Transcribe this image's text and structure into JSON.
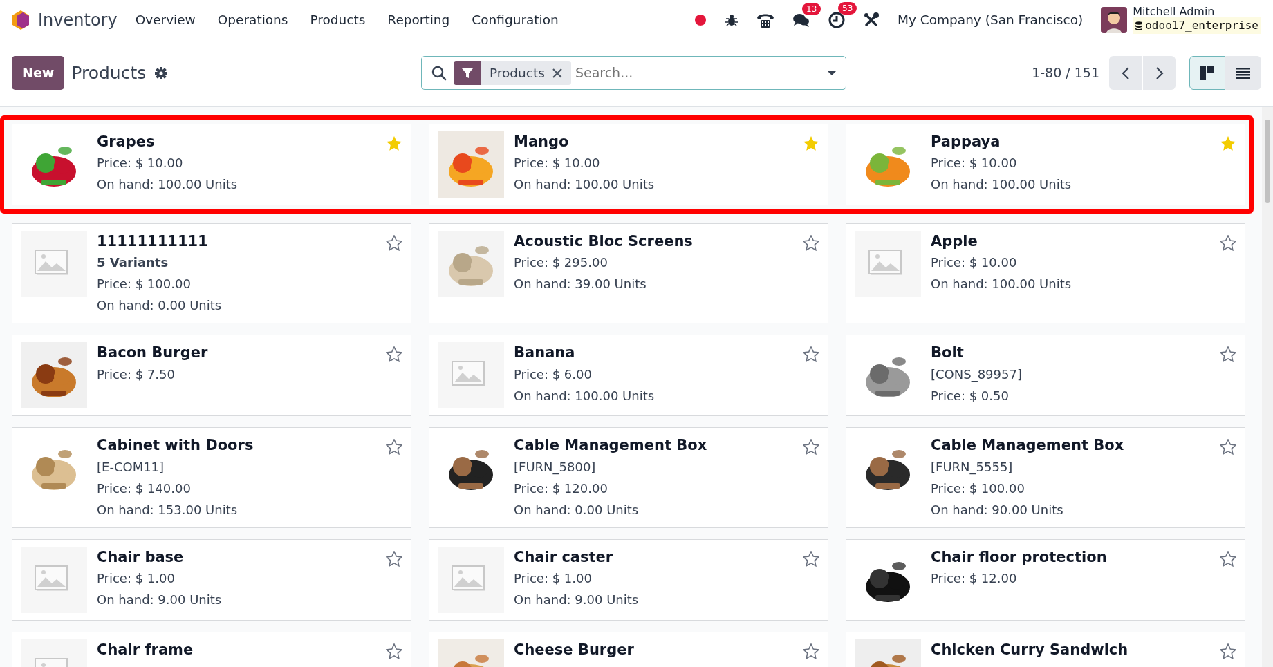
{
  "app": {
    "name": "Inventory"
  },
  "menu": [
    "Overview",
    "Operations",
    "Products",
    "Reporting",
    "Configuration"
  ],
  "systray": {
    "chat_count": "13",
    "activity_count": "53",
    "company": "My Company (San Francisco)",
    "user": "Mitchell Admin",
    "database": "odoo17_enterprise"
  },
  "control_panel": {
    "new_button": "New",
    "title": "Products",
    "facet": "Products",
    "search_placeholder": "Search...",
    "pager": "1-80 / 151",
    "views": [
      {
        "kind": "kanban",
        "selected": true
      },
      {
        "kind": "list",
        "selected": false
      }
    ]
  },
  "rows": [
    {
      "highlighted": true,
      "cards": [
        {
          "name": "Grapes",
          "image": true,
          "favorite": true,
          "lines": [
            {
              "text": "Price: $ 10.00",
              "bold": false
            },
            {
              "text": "On hand: 100.00 Units",
              "bold": false
            }
          ]
        },
        {
          "name": "Mango",
          "image": true,
          "favorite": true,
          "lines": [
            {
              "text": "Price: $ 10.00",
              "bold": false
            },
            {
              "text": "On hand: 100.00 Units",
              "bold": false
            }
          ]
        },
        {
          "name": "Pappaya",
          "image": true,
          "favorite": true,
          "lines": [
            {
              "text": "Price: $ 10.00",
              "bold": false
            },
            {
              "text": "On hand: 100.00 Units",
              "bold": false
            }
          ]
        }
      ]
    },
    {
      "highlighted": false,
      "cards": [
        {
          "name": "11111111111",
          "image": false,
          "favorite": false,
          "lines": [
            {
              "text": "5 Variants",
              "bold": true
            },
            {
              "text": "Price: $ 100.00",
              "bold": false
            },
            {
              "text": "On hand: 0.00 Units",
              "bold": false
            }
          ]
        },
        {
          "name": "Acoustic Bloc Screens",
          "image": true,
          "favorite": false,
          "lines": [
            {
              "text": "Price: $ 295.00",
              "bold": false
            },
            {
              "text": "On hand: 39.00 Units",
              "bold": false
            }
          ]
        },
        {
          "name": "Apple",
          "image": false,
          "favorite": false,
          "lines": [
            {
              "text": "Price: $ 10.00",
              "bold": false
            },
            {
              "text": "On hand: 100.00 Units",
              "bold": false
            }
          ]
        }
      ]
    },
    {
      "highlighted": false,
      "cards": [
        {
          "name": "Bacon Burger",
          "image": true,
          "favorite": false,
          "lines": [
            {
              "text": "Price: $ 7.50",
              "bold": false
            }
          ]
        },
        {
          "name": "Banana",
          "image": false,
          "favorite": false,
          "lines": [
            {
              "text": "Price: $ 6.00",
              "bold": false
            },
            {
              "text": "On hand: 100.00 Units",
              "bold": false
            }
          ]
        },
        {
          "name": "Bolt",
          "image": true,
          "favorite": false,
          "lines": [
            {
              "text": "[CONS_89957]",
              "bold": false
            },
            {
              "text": "Price: $ 0.50",
              "bold": false
            }
          ]
        }
      ]
    },
    {
      "highlighted": false,
      "cards": [
        {
          "name": "Cabinet with Doors",
          "image": true,
          "favorite": false,
          "lines": [
            {
              "text": "[E-COM11]",
              "bold": false
            },
            {
              "text": "Price: $ 140.00",
              "bold": false
            },
            {
              "text": "On hand: 153.00 Units",
              "bold": false
            }
          ]
        },
        {
          "name": "Cable Management Box",
          "image": true,
          "favorite": false,
          "lines": [
            {
              "text": "[FURN_5800]",
              "bold": false
            },
            {
              "text": "Price: $ 120.00",
              "bold": false
            },
            {
              "text": "On hand: 0.00 Units",
              "bold": false
            }
          ]
        },
        {
          "name": "Cable Management Box",
          "image": true,
          "favorite": false,
          "lines": [
            {
              "text": "[FURN_5555]",
              "bold": false
            },
            {
              "text": "Price: $ 100.00",
              "bold": false
            },
            {
              "text": "On hand: 90.00 Units",
              "bold": false
            }
          ]
        }
      ]
    },
    {
      "highlighted": false,
      "cards": [
        {
          "name": "Chair base",
          "image": false,
          "favorite": false,
          "lines": [
            {
              "text": "Price: $ 1.00",
              "bold": false
            },
            {
              "text": "On hand: 9.00 Units",
              "bold": false
            }
          ]
        },
        {
          "name": "Chair caster",
          "image": false,
          "favorite": false,
          "lines": [
            {
              "text": "Price: $ 1.00",
              "bold": false
            },
            {
              "text": "On hand: 9.00 Units",
              "bold": false
            }
          ]
        },
        {
          "name": "Chair floor protection",
          "image": true,
          "favorite": false,
          "lines": [
            {
              "text": "Price: $ 12.00",
              "bold": false
            }
          ]
        }
      ]
    },
    {
      "highlighted": false,
      "cards": [
        {
          "name": "Chair frame",
          "image": false,
          "favorite": false
        },
        {
          "name": "Cheese Burger",
          "image": true,
          "favorite": false
        },
        {
          "name": "Chicken Curry Sandwich",
          "image": true,
          "favorite": false
        }
      ]
    }
  ]
}
